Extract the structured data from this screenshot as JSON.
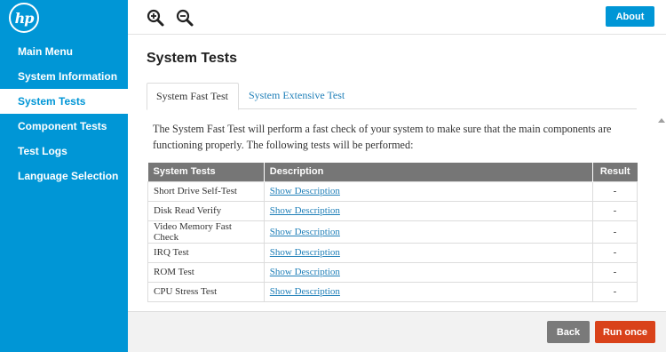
{
  "brand": {
    "logo_text": "hp",
    "colors": {
      "primary": "#0096d6",
      "danger": "#d9421a",
      "neutral": "#7a7a7a"
    }
  },
  "sidebar": {
    "items": [
      {
        "label": "Main Menu",
        "active": false
      },
      {
        "label": "System Information",
        "active": false
      },
      {
        "label": "System Tests",
        "active": true
      },
      {
        "label": "Component Tests",
        "active": false
      },
      {
        "label": "Test Logs",
        "active": false
      },
      {
        "label": "Language Selection",
        "active": false
      }
    ]
  },
  "toolbar": {
    "zoom_in_icon": "zoom-in-icon",
    "zoom_out_icon": "zoom-out-icon",
    "about_label": "About"
  },
  "main": {
    "title": "System Tests",
    "tabs": [
      {
        "label": "System Fast Test",
        "active": true
      },
      {
        "label": "System Extensive Test",
        "active": false
      }
    ],
    "description": "The System Fast Test will perform a fast check of your system to make sure that the main components are functioning properly. The following tests will be performed:",
    "table": {
      "headers": [
        "System Tests",
        "Description",
        "Result"
      ],
      "rows": [
        {
          "test": "Short Drive Self-Test",
          "description": "Show Description",
          "result": "-"
        },
        {
          "test": "Disk Read Verify",
          "description": "Show Description",
          "result": "-"
        },
        {
          "test": "Video Memory Fast Check",
          "description": "Show Description",
          "result": "-"
        },
        {
          "test": "IRQ Test",
          "description": "Show Description",
          "result": "-"
        },
        {
          "test": "ROM Test",
          "description": "Show Description",
          "result": "-"
        },
        {
          "test": "CPU Stress Test",
          "description": "Show Description",
          "result": "-"
        }
      ]
    }
  },
  "footer": {
    "back_label": "Back",
    "run_label": "Run once"
  }
}
